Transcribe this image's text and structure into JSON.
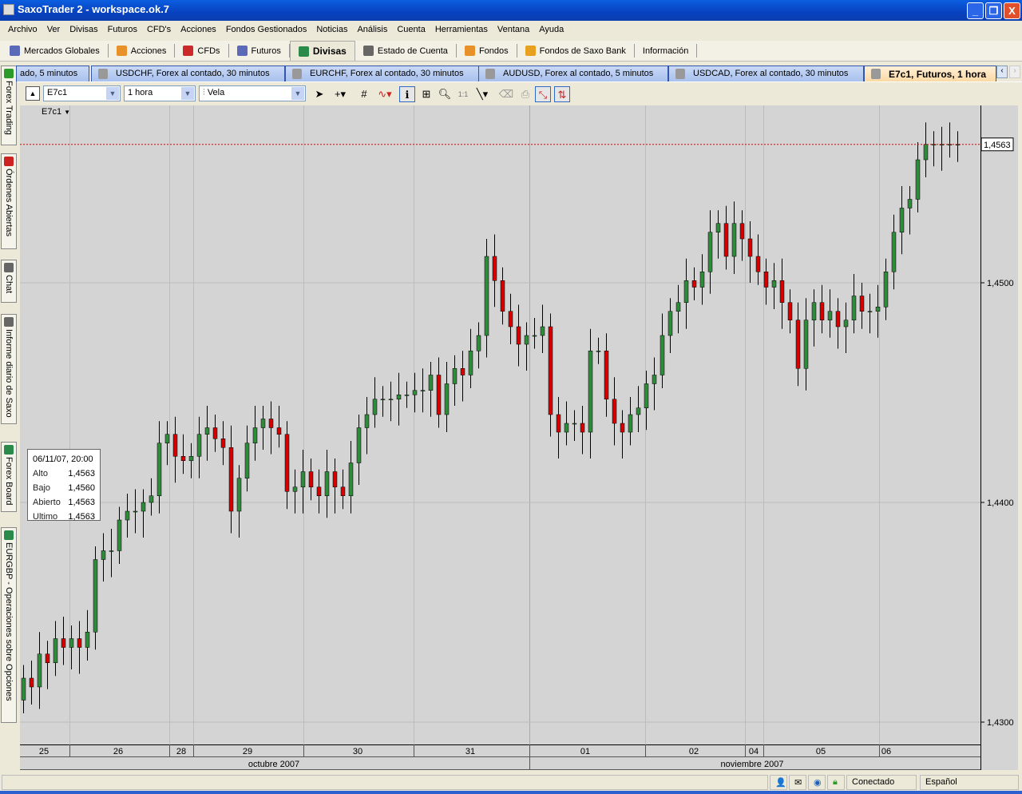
{
  "window": {
    "title": "SaxoTrader 2 - workspace.ok.7",
    "min": "_",
    "max": "❐",
    "close": "X"
  },
  "menu": [
    "Archivo",
    "Ver",
    "Divisas",
    "Futuros",
    "CFD's",
    "Acciones",
    "Fondos Gestionados",
    "Noticias",
    "Análisis",
    "Cuenta",
    "Herramientas",
    "Ventana",
    "Ayuda"
  ],
  "nav": [
    {
      "label": "Mercados Globales",
      "icon": "gear-icon",
      "color": "#5a6ab8"
    },
    {
      "label": "Acciones",
      "icon": "acciones-icon",
      "color": "#e8902a"
    },
    {
      "label": "CFDs",
      "icon": "cfd-icon",
      "color": "#cc2a2a"
    },
    {
      "label": "Futuros",
      "icon": "futuros-icon",
      "color": "#5a6ab8"
    },
    {
      "label": "Divisas",
      "icon": "divisas-icon",
      "color": "#2a8a4a"
    },
    {
      "label": "Estado de Cuenta",
      "icon": "account-icon",
      "color": "#666666"
    },
    {
      "label": "Fondos",
      "icon": "fondos-icon",
      "color": "#e8902a"
    },
    {
      "label": "Fondos de Saxo Bank",
      "icon": "saxo-funds-icon",
      "color": "#e8a020"
    },
    {
      "label": "Información",
      "icon": "",
      "color": ""
    }
  ],
  "sidebar": [
    "Forex Trading",
    "Órdenes Abiertas",
    "Chat",
    "Informe diario de Saxo",
    "Forex Board",
    "EURGBP - Operaciones sobre Opciones Forex"
  ],
  "chart_tabs": [
    "ado, 5 minutos",
    "USDCHF, Forex al contado, 30 minutos",
    "EURCHF, Forex al contado, 30 minutos",
    "AUDUSD, Forex al contado, 5 minutos",
    "USDCAD, Forex al contado, 30 minutos",
    "E7c1, Futuros, 1 hora"
  ],
  "toolbar": {
    "symbol": "E7c1",
    "interval": "1 hora",
    "chart_type": "Vela"
  },
  "chart_label": "E7c1",
  "info": {
    "datetime": "06/11/07, 20:00",
    "rows": [
      {
        "k": "Alto",
        "v": "1,4563"
      },
      {
        "k": "Bajo",
        "v": "1,4560"
      },
      {
        "k": "Abierto",
        "v": "1,4563"
      },
      {
        "k": "Ultimo",
        "v": "1,4563"
      }
    ]
  },
  "status": {
    "connection": "Conectado",
    "language": "Español"
  },
  "chart_data": {
    "type": "candlestick",
    "symbol": "E7c1",
    "interval": "1 hora",
    "y_ticks": [
      {
        "value": 1.45,
        "label": "1,4500"
      },
      {
        "value": 1.44,
        "label": "1,4400"
      },
      {
        "value": 1.43,
        "label": "1,4300"
      }
    ],
    "last_price": {
      "value": 1.4563,
      "label": "1,4563",
      "color": "#dd0000"
    },
    "days": [
      "25",
      "26",
      "28",
      "29",
      "30",
      "31",
      "01",
      "02",
      "04",
      "05",
      "06"
    ],
    "months": [
      "octubre 2007",
      "noviembre 2007"
    ],
    "open_first": 1.431,
    "closes": [
      1.432,
      1.4316,
      1.4331,
      1.4327,
      1.4338,
      1.4334,
      1.4338,
      1.4334,
      1.4341,
      1.4374,
      1.4378,
      1.4378,
      1.4392,
      1.4396,
      1.4396,
      1.44,
      1.4403,
      1.4427,
      1.4431,
      1.4421,
      1.4419,
      1.4421,
      1.4431,
      1.4434,
      1.4429,
      1.4425,
      1.4396,
      1.4411,
      1.4427,
      1.4434,
      1.4438,
      1.4434,
      1.4431,
      1.4405,
      1.4407,
      1.4414,
      1.4407,
      1.4403,
      1.4414,
      1.4407,
      1.4403,
      1.4418,
      1.4434,
      1.444,
      1.4447,
      1.4447,
      1.4447,
      1.4449,
      1.4449,
      1.4451,
      1.4451,
      1.4458,
      1.444,
      1.4454,
      1.4461,
      1.4458,
      1.4469,
      1.4476,
      1.4512,
      1.4501,
      1.4487,
      1.448,
      1.4472,
      1.4476,
      1.4476,
      1.448,
      1.444,
      1.4432,
      1.4436,
      1.4436,
      1.4432,
      1.4469,
      1.4469,
      1.4447,
      1.4436,
      1.4432,
      1.444,
      1.4443,
      1.4454,
      1.4458,
      1.4476,
      1.4487,
      1.4491,
      1.4501,
      1.4498,
      1.4505,
      1.4523,
      1.4527,
      1.4512,
      1.4527,
      1.452,
      1.4512,
      1.4505,
      1.4498,
      1.4501,
      1.4491,
      1.4483,
      1.4461,
      1.4483,
      1.4491,
      1.4483,
      1.4487,
      1.448,
      1.4483,
      1.4494,
      1.4487,
      1.4487,
      1.4489,
      1.4505,
      1.4523,
      1.4534,
      1.4538,
      1.4556,
      1.4563,
      1.4563,
      1.4563,
      1.4563,
      1.4563
    ],
    "colors": {
      "up": "#2e8b3a",
      "down": "#d40000",
      "wick": "#000000"
    }
  }
}
